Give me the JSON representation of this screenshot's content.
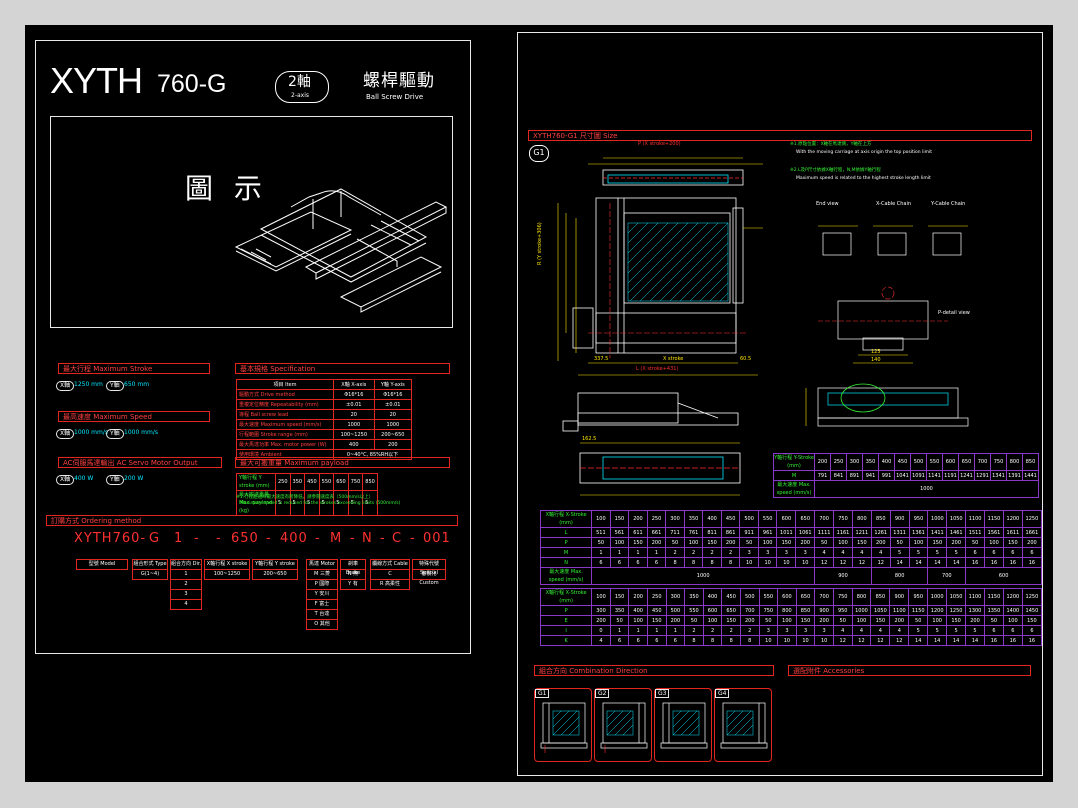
{
  "left": {
    "title_main": "XYTH",
    "title_model": "760-G",
    "axis_cn": "2軸",
    "axis_en": "2-axis",
    "drive_cn": "螺桿驅動",
    "drive_en": "Ball Screw Drive",
    "illustration_label": "圖 示",
    "stroke": {
      "title": "最大行程  Maximum Stroke",
      "items": [
        {
          "axis": "X軸",
          "value": "1250 mm"
        },
        {
          "axis": "Y軸",
          "value": "650 mm"
        }
      ]
    },
    "speed": {
      "title": "最高速度  Maximum Speed",
      "items": [
        {
          "axis": "X軸",
          "value": "1000 mm/s"
        },
        {
          "axis": "Y軸",
          "value": "1000 mm/s"
        }
      ]
    },
    "motor": {
      "title": "AC伺服馬達輸出  AC Servo Motor Output",
      "items": [
        {
          "axis": "X軸",
          "value": "400 W"
        },
        {
          "axis": "Y軸",
          "value": "200 W"
        }
      ]
    },
    "spec": {
      "title": "基本規格  Specification",
      "header": [
        "項目 Item",
        "X軸 X-axis",
        "Y軸 Y-axis"
      ],
      "rows": [
        [
          "驅動方式  Drive method",
          "Φ16*16",
          "Φ16*16"
        ],
        [
          "重複定位精度  Repeatability (mm)",
          "±0.01",
          "±0.01"
        ],
        [
          "導程  Ball screw lead",
          "20",
          "20"
        ],
        [
          "最大速度  Maximum speed (mm/s)",
          "1000",
          "1000"
        ],
        [
          "行程範圍  Stroke range (mm)",
          "100~1250",
          "200~650"
        ],
        [
          "最大馬達功率  Max. motor power (W)",
          "400",
          "200"
        ],
        [
          "使用環境  Ambient",
          "0~40°C, 85%RH以下",
          ""
        ]
      ]
    },
    "payload": {
      "title": "最大可搬重量  Maximum payload",
      "header": [
        "Y軸行程 Y stroke (mm)",
        "250",
        "350",
        "450",
        "550",
        "650",
        "750",
        "850"
      ],
      "row": [
        "最大搬送重量 Max. payload (kg)",
        "5",
        "5",
        "5",
        "5",
        "5",
        "5",
        "5"
      ],
      "note1": "※1.行程超過時最大速度有所降低，請參閱速度表（500mm/s以上）",
      "note2": "Maximum speed is reduced for the strokes exceeding limits (500mm/s)"
    },
    "ordering": {
      "title": "訂購方式  Ordering method",
      "code": [
        "XYTH760-",
        "G",
        "1",
        "650",
        "400",
        "M",
        "N",
        "C",
        "001"
      ],
      "separators": [
        "-",
        "-",
        "-",
        "-",
        "-",
        "-",
        "-"
      ],
      "boxes": [
        {
          "label": "型號 Model"
        },
        {
          "label": "組合形式 Type",
          "options": [
            "G(1~4)"
          ]
        },
        {
          "label": "組合方向 Dir.",
          "options": [
            "1",
            "2",
            "3",
            "4"
          ]
        },
        {
          "label": "X軸行程 X stroke",
          "options": [
            "100~1250"
          ]
        },
        {
          "label": "Y軸行程 Y stroke",
          "options": [
            "200~650"
          ]
        },
        {
          "label": "馬達 Motor",
          "options": [
            "M 三菱",
            "P 國際",
            "Y 安川",
            "F 富士",
            "T 台達",
            "O 其他"
          ]
        },
        {
          "label": "剎車 Brake",
          "options": [
            "N 無",
            "Y 有"
          ]
        },
        {
          "label": "纜線方式 Cable",
          "options": [
            "C",
            "R 高柔性"
          ]
        },
        {
          "label": "特殊代號 Special",
          "options": [
            "客製化 Custom"
          ]
        }
      ]
    }
  },
  "right": {
    "size_title": "XYTH760-G1 尺寸圖 Size",
    "g1_label": "G1",
    "views": {
      "end_view": "End view",
      "x_cable": "X-Cable Chain",
      "y_cable": "Y-Cable Chain",
      "detail_view": "P-detail view"
    },
    "notes": [
      "※1.原點位置：X軸在馬達側，Y軸在上方",
      "With the moving carriage at axis origin the top position limit",
      "※2.L及P尺寸依據X軸行程，N,M依據Y軸行程",
      "Maximum speed is related to the highest stroke length limit"
    ],
    "dims": {
      "top": "P (X stroke+200)",
      "left_vertical": "R (Y stroke+306)",
      "bottom": "L (X stroke+431)",
      "bottom_mid": "X stroke",
      "right_a": "60.5",
      "left_a": "337.5",
      "dim_162": "162.5",
      "dim_125": "125",
      "dim_140": "140"
    },
    "y_table": {
      "header": [
        "Y軸行程 Y-Stroke (mm)",
        "200",
        "250",
        "300",
        "350",
        "400",
        "450",
        "500",
        "550",
        "600",
        "650",
        "700",
        "750",
        "800",
        "850"
      ],
      "rows": [
        [
          "M",
          "791",
          "841",
          "891",
          "941",
          "991",
          "1041",
          "1091",
          "1141",
          "1191",
          "1241",
          "1291",
          "1341",
          "1391",
          "1441"
        ],
        [
          "最大速度 Max. speed (mm/s)",
          "1000"
        ]
      ]
    },
    "x_table": {
      "header": [
        "X軸行程 X-Stroke (mm)",
        "100",
        "150",
        "200",
        "250",
        "300",
        "350",
        "400",
        "450",
        "500",
        "550",
        "600",
        "650",
        "700",
        "750",
        "800",
        "850",
        "900",
        "950",
        "1000",
        "1050",
        "1100",
        "1150",
        "1200",
        "1250"
      ],
      "rows": [
        [
          "L",
          "511",
          "561",
          "611",
          "661",
          "711",
          "761",
          "811",
          "861",
          "911",
          "961",
          "1011",
          "1061",
          "1111",
          "1161",
          "1211",
          "1261",
          "1311",
          "1361",
          "1411",
          "1461",
          "1511",
          "1561",
          "1611",
          "1661"
        ],
        [
          "P",
          "50",
          "100",
          "150",
          "200",
          "50",
          "100",
          "150",
          "200",
          "50",
          "100",
          "150",
          "200",
          "50",
          "100",
          "150",
          "200",
          "50",
          "100",
          "150",
          "200",
          "50",
          "100",
          "150",
          "200"
        ],
        [
          "M",
          "1",
          "1",
          "1",
          "1",
          "2",
          "2",
          "2",
          "2",
          "3",
          "3",
          "3",
          "3",
          "4",
          "4",
          "4",
          "4",
          "5",
          "5",
          "5",
          "5",
          "6",
          "6",
          "6",
          "6"
        ],
        [
          "N",
          "6",
          "6",
          "6",
          "6",
          "8",
          "8",
          "8",
          "8",
          "10",
          "10",
          "10",
          "10",
          "12",
          "12",
          "12",
          "12",
          "14",
          "14",
          "14",
          "14",
          "16",
          "16",
          "16",
          "16"
        ],
        [
          "最大速度 Max. speed (mm/s)",
          "1000",
          "900",
          "800",
          "700",
          "600"
        ]
      ]
    },
    "x2_table": {
      "header": [
        "X軸行程 X-Stroke (mm)",
        "100",
        "150",
        "200",
        "250",
        "300",
        "350",
        "400",
        "450",
        "500",
        "550",
        "600",
        "650",
        "700",
        "750",
        "800",
        "850",
        "900",
        "950",
        "1000",
        "1050",
        "1100",
        "1150",
        "1200",
        "1250"
      ],
      "rows": [
        [
          "P",
          "300",
          "350",
          "400",
          "450",
          "500",
          "550",
          "600",
          "650",
          "700",
          "750",
          "800",
          "850",
          "900",
          "950",
          "1000",
          "1050",
          "1100",
          "1150",
          "1200",
          "1250",
          "1300",
          "1350",
          "1400",
          "1450"
        ],
        [
          "E",
          "200",
          "50",
          "100",
          "150",
          "200",
          "50",
          "100",
          "150",
          "200",
          "50",
          "100",
          "150",
          "200",
          "50",
          "100",
          "150",
          "200",
          "50",
          "100",
          "150",
          "200",
          "50",
          "100",
          "150"
        ],
        [
          "I",
          "0",
          "1",
          "1",
          "1",
          "1",
          "2",
          "2",
          "2",
          "2",
          "3",
          "3",
          "3",
          "3",
          "4",
          "4",
          "4",
          "4",
          "5",
          "5",
          "5",
          "5",
          "6",
          "6",
          "6"
        ],
        [
          "K",
          "4",
          "6",
          "6",
          "6",
          "6",
          "8",
          "8",
          "8",
          "8",
          "10",
          "10",
          "10",
          "10",
          "12",
          "12",
          "12",
          "12",
          "14",
          "14",
          "14",
          "14",
          "16",
          "16",
          "16"
        ]
      ]
    },
    "combination_title": "組合方向  Combination Direction",
    "accessories_title": "選配附件  Accessories",
    "combos": [
      "G1",
      "G2",
      "G3",
      "G4"
    ]
  }
}
